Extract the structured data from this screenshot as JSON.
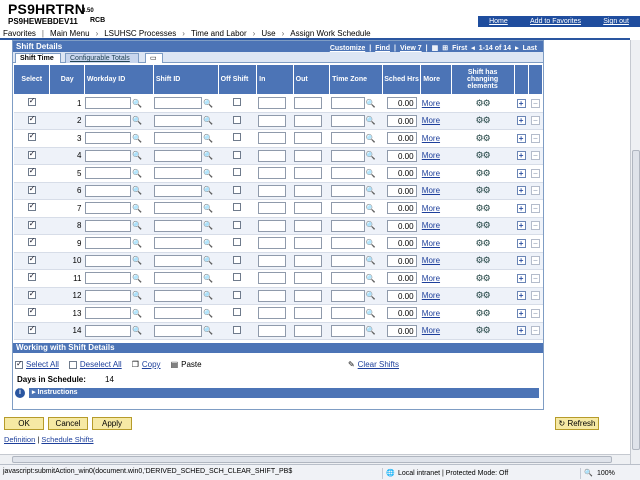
{
  "header": {
    "system": "PS9HRTRN",
    "version": "8.50",
    "database": "PS9HEWEBDEV11",
    "user": "RCB",
    "links": [
      "Home",
      "Add to Favorites",
      "Sign out"
    ]
  },
  "breadcrumb": [
    "Favorites",
    "Main Menu",
    "LSUHSC Processes",
    "Time and Labor",
    "Use",
    "Assign Work Schedule"
  ],
  "grid": {
    "title": "Shift Details",
    "customize": "Customize",
    "find": "Find",
    "view": "View 7",
    "first": "First",
    "count": "1-14 of 14",
    "last": "Last",
    "tabs": [
      "Shift Time",
      "Configurable Totals"
    ],
    "columns": [
      "Select",
      "Day",
      "Workday ID",
      "Shift ID",
      "Off Shift",
      "In",
      "Out",
      "Time Zone",
      "Sched Hrs",
      "More",
      "Shift has changing elements"
    ],
    "more_label": "More",
    "rows": [
      {
        "day": "1",
        "hrs": "0.00"
      },
      {
        "day": "2",
        "hrs": "0.00"
      },
      {
        "day": "3",
        "hrs": "0.00"
      },
      {
        "day": "4",
        "hrs": "0.00"
      },
      {
        "day": "5",
        "hrs": "0.00"
      },
      {
        "day": "6",
        "hrs": "0.00"
      },
      {
        "day": "7",
        "hrs": "0.00"
      },
      {
        "day": "8",
        "hrs": "0.00"
      },
      {
        "day": "9",
        "hrs": "0.00"
      },
      {
        "day": "10",
        "hrs": "0.00"
      },
      {
        "day": "11",
        "hrs": "0.00"
      },
      {
        "day": "12",
        "hrs": "0.00"
      },
      {
        "day": "13",
        "hrs": "0.00"
      },
      {
        "day": "14",
        "hrs": "0.00"
      }
    ]
  },
  "working": {
    "title": "Working with Shift Details",
    "select_all": "Select All",
    "deselect_all": "Deselect All",
    "copy": "Copy",
    "paste": "Paste",
    "clear": "Clear Shifts",
    "days_label": "Days in Schedule:",
    "days_value": "14",
    "instructions": "Instructions"
  },
  "buttons": {
    "ok": "OK",
    "cancel": "Cancel",
    "apply": "Apply",
    "refresh": "Refresh"
  },
  "footer": {
    "definition": "Definition",
    "schedule_shifts": "Schedule Shifts"
  },
  "status": {
    "text": "javascript:submitAction_win0(document.win0,'DERIVED_SCHED_SCH_CLEAR_SHIFT_PB$",
    "zone": "Local intranet | Protected Mode: Off",
    "zoom": "100%"
  }
}
